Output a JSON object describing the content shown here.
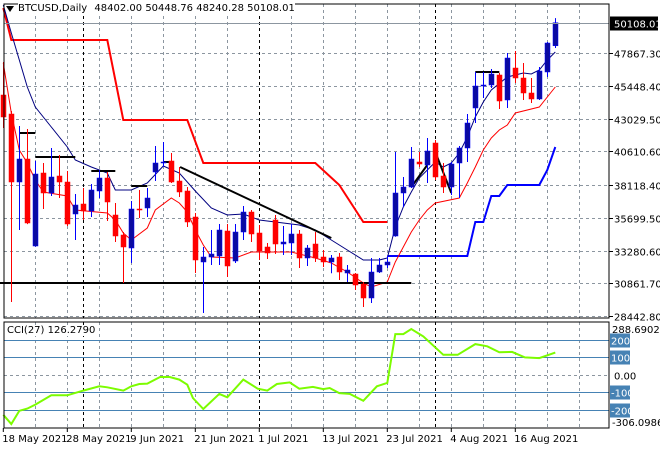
{
  "header": {
    "symbol": "BTCUSD,Daily",
    "open": "48402.00",
    "high": "50448.76",
    "low": "48240.28",
    "close": "50108.01"
  },
  "current_price_label": "50108.01",
  "price_axis": {
    "ticks": [
      "47867.30",
      "45448.40",
      "43029.50",
      "40610.60",
      "38118.40",
      "35699.50",
      "33280.60",
      "30861.70",
      "28442.80"
    ]
  },
  "date_axis": {
    "labels": [
      "18 May 2021",
      "28 May 2021",
      "9 Jun 2021",
      "21 Jun 2021",
      "1 Jul 2021",
      "13 Jul 2021",
      "23 Jul 2021",
      "4 Aug 2021",
      "16 Aug 2021"
    ],
    "label_bar_indices": [
      0,
      8,
      16,
      24,
      32,
      40,
      48,
      56,
      64
    ],
    "month_separator_indices": [
      10,
      32,
      54
    ]
  },
  "colors": {
    "bull_body": "#0a0aa0",
    "bull_wick": "#0000ff",
    "bear": "#ff0000",
    "ma_fast": "#000080",
    "ma_slow": "#ff0000",
    "channel_upper": "#ff0000",
    "channel_lower": "#0000ff",
    "cci": "#7cfc00",
    "cci_levels": "#4682b4",
    "grid": "#8c96a0"
  },
  "candles": [
    [
      44766,
      47204,
      42329,
      43141
    ],
    [
      43363,
      43585,
      29477,
      38340
    ],
    [
      38340,
      42477,
      34795,
      40039
    ],
    [
      40039,
      42255,
      35230,
      35312
    ],
    [
      33613,
      39892,
      33560,
      38931
    ],
    [
      39005,
      39744,
      36346,
      37528
    ],
    [
      37528,
      40852,
      37306,
      38710
    ],
    [
      38784,
      40335,
      37159,
      38340
    ],
    [
      38340,
      39153,
      35091,
      35238
    ],
    [
      35977,
      37454,
      34057,
      36642
    ],
    [
      36715,
      37897,
      35534,
      36198
    ],
    [
      36198,
      38193,
      35755,
      37750
    ],
    [
      37676,
      39227,
      37159,
      38636
    ],
    [
      38636,
      39079,
      35460,
      36863
    ],
    [
      35903,
      36789,
      33909,
      34352
    ],
    [
      34426,
      34647,
      30881,
      33540
    ],
    [
      33465,
      36937,
      32358,
      36346
    ],
    [
      36346,
      37750,
      35681,
      36272
    ],
    [
      36420,
      37897,
      35755,
      37159
    ],
    [
      39079,
      41000,
      38414,
      39744
    ],
    [
      39744,
      41295,
      39448,
      39818
    ],
    [
      39892,
      40483,
      38266,
      38340
    ],
    [
      38414,
      39448,
      37232,
      37602
    ],
    [
      37676,
      37971,
      35017,
      35386
    ],
    [
      35756,
      36051,
      31620,
      32579
    ],
    [
      32432,
      33540,
      28665,
      32801
    ],
    [
      32801,
      34795,
      32210,
      33022
    ],
    [
      32875,
      35238,
      32210,
      34795
    ],
    [
      34721,
      35238,
      31324,
      32136
    ],
    [
      32505,
      35238,
      32358,
      34647
    ],
    [
      34647,
      36567,
      34057,
      36124
    ],
    [
      36124,
      36272,
      33909,
      34500
    ],
    [
      34574,
      35164,
      32579,
      33244
    ],
    [
      33540,
      33835,
      32653,
      33096
    ],
    [
      35534,
      35903,
      33022,
      33761
    ],
    [
      33761,
      35091,
      32949,
      33909
    ],
    [
      33835,
      35238,
      32949,
      34500
    ],
    [
      34500,
      34795,
      31989,
      32727
    ],
    [
      32727,
      33687,
      32136,
      33465
    ],
    [
      33761,
      34647,
      32431,
      32727
    ],
    [
      32801,
      33318,
      32062,
      32432
    ],
    [
      32432,
      32949,
      31604,
      32727
    ],
    [
      32801,
      33096,
      31102,
      31693
    ],
    [
      31619,
      32210,
      30954,
      31841
    ],
    [
      31545,
      31619,
      30364,
      30733
    ],
    [
      30807,
      30954,
      29108,
      29773
    ],
    [
      29773,
      32727,
      29403,
      31693
    ],
    [
      31693,
      32727,
      31619,
      32210
    ],
    [
      32210,
      32875,
      31989,
      32432
    ],
    [
      34352,
      40556,
      34300,
      37528
    ],
    [
      37528,
      38710,
      36494,
      37971
    ],
    [
      37971,
      40926,
      37897,
      40039
    ],
    [
      39818,
      40556,
      39448,
      39670
    ],
    [
      39596,
      41590,
      38266,
      40630
    ],
    [
      41221,
      41443,
      38488,
      38710
    ],
    [
      38784,
      39744,
      37528,
      37971
    ],
    [
      37971,
      39818,
      37380,
      39670
    ],
    [
      39744,
      41000,
      37159,
      40852
    ],
    [
      40852,
      43363,
      39818,
      42698
    ],
    [
      43806,
      46465,
      42698,
      45431
    ],
    [
      45431,
      46465,
      44545,
      45505
    ],
    [
      45505,
      46687,
      45283,
      46317
    ],
    [
      46244,
      46391,
      43732,
      44323
    ],
    [
      44397,
      47868,
      43806,
      47499
    ],
    [
      46760,
      48016,
      45653,
      46022
    ],
    [
      46022,
      47130,
      44397,
      44914
    ],
    [
      44914,
      46022,
      44175,
      44471
    ],
    [
      44471,
      46834,
      44400,
      46539
    ],
    [
      46465,
      48681,
      46096,
      48607
    ],
    [
      48402,
      50448.76,
      48240.28,
      50108.01
    ]
  ],
  "indicators": {
    "ma_fast": [
      [
        0,
        51414
      ],
      [
        1,
        49346
      ],
      [
        2,
        47351
      ],
      [
        3,
        45357
      ],
      [
        4,
        43880
      ],
      [
        6,
        42402
      ],
      [
        8,
        40926
      ],
      [
        9,
        39965
      ],
      [
        11,
        39448
      ],
      [
        13,
        39005
      ],
      [
        14,
        37750
      ],
      [
        16,
        37750
      ],
      [
        18,
        38266
      ],
      [
        20,
        39522
      ],
      [
        22,
        39005
      ],
      [
        24,
        37676
      ],
      [
        26,
        36420
      ],
      [
        28,
        35903
      ],
      [
        30,
        35977
      ],
      [
        32,
        35534
      ],
      [
        35,
        35312
      ],
      [
        37,
        35164
      ],
      [
        39,
        34795
      ],
      [
        41,
        34057
      ],
      [
        43,
        33318
      ],
      [
        45,
        32579
      ],
      [
        47,
        32579
      ],
      [
        48,
        32727
      ],
      [
        49,
        35017
      ],
      [
        50,
        36494
      ],
      [
        51,
        37602
      ],
      [
        52,
        38636
      ],
      [
        54,
        39818
      ],
      [
        55,
        39448
      ],
      [
        56,
        39744
      ],
      [
        57,
        40483
      ],
      [
        58,
        41664
      ],
      [
        59,
        43141
      ],
      [
        60,
        44249
      ],
      [
        61,
        45136
      ],
      [
        63,
        46096
      ],
      [
        65,
        46391
      ],
      [
        66,
        46317
      ],
      [
        67,
        46613
      ],
      [
        68,
        47351
      ],
      [
        69,
        47942
      ]
    ],
    "ma_slow": [
      [
        0,
        47130
      ],
      [
        1,
        43437
      ],
      [
        2,
        40704
      ],
      [
        3,
        39744
      ],
      [
        4,
        38488
      ],
      [
        5,
        37602
      ],
      [
        8,
        37306
      ],
      [
        9,
        36272
      ],
      [
        13,
        36051
      ],
      [
        14,
        35534
      ],
      [
        15,
        34573
      ],
      [
        16,
        34057
      ],
      [
        18,
        34943
      ],
      [
        19,
        36272
      ],
      [
        21,
        37159
      ],
      [
        22,
        36789
      ],
      [
        23,
        36124
      ],
      [
        24,
        34795
      ],
      [
        25,
        33687
      ],
      [
        26,
        32801
      ],
      [
        29,
        32727
      ],
      [
        31,
        33170
      ],
      [
        36,
        33170
      ],
      [
        39,
        32727
      ],
      [
        41,
        32358
      ],
      [
        43,
        31693
      ],
      [
        45,
        30881
      ],
      [
        46,
        30585
      ],
      [
        48,
        30954
      ],
      [
        49,
        32432
      ],
      [
        50,
        33540
      ],
      [
        51,
        34647
      ],
      [
        52,
        35534
      ],
      [
        53,
        36272
      ],
      [
        54,
        36789
      ],
      [
        57,
        37159
      ],
      [
        58,
        38266
      ],
      [
        59,
        39448
      ],
      [
        60,
        40704
      ],
      [
        61,
        41590
      ],
      [
        62,
        42181
      ],
      [
        63,
        42550
      ],
      [
        64,
        43437
      ],
      [
        67,
        43880
      ],
      [
        68,
        44619
      ],
      [
        69,
        45357
      ]
    ],
    "channel_upper": [
      [
        0,
        51192
      ],
      [
        1,
        48829
      ],
      [
        13,
        48829
      ],
      [
        15,
        42920
      ],
      [
        23,
        42920
      ],
      [
        25,
        39744
      ],
      [
        39,
        39744
      ],
      [
        42,
        38119
      ],
      [
        45,
        35386
      ],
      [
        48,
        35386
      ]
    ],
    "channel_lower": [
      [
        48,
        32875
      ],
      [
        58,
        32875
      ],
      [
        59,
        35386
      ],
      [
        60,
        35386
      ],
      [
        61,
        37306
      ],
      [
        62,
        37306
      ],
      [
        63,
        38119
      ],
      [
        67,
        38119
      ],
      [
        68,
        39227
      ],
      [
        69,
        40926
      ]
    ]
  },
  "drawings": {
    "support_line": {
      "price": 30881,
      "from": -1,
      "to": 51
    },
    "trend_line": [
      [
        22.1,
        39448
      ],
      [
        41,
        34205
      ]
    ],
    "levels": [
      [
        2,
        4,
        41960
      ],
      [
        4,
        9,
        40187
      ],
      [
        11,
        14,
        39153
      ],
      [
        16,
        18,
        38045
      ],
      [
        20,
        21,
        39818
      ],
      [
        59,
        62,
        46465
      ]
    ],
    "segments": [
      [
        [
          51,
          37971
        ],
        [
          53,
          39596
        ]
      ],
      [
        [
          54,
          40556
        ],
        [
          56,
          37528
        ]
      ]
    ]
  },
  "cci": {
    "label": "CCI(27) 126.2790",
    "scale_max": "288.6902",
    "scale_min": "-306.0986",
    "levels": [
      "200",
      "100",
      "0.00",
      "-100",
      "-200"
    ],
    "level_values": [
      200,
      100,
      0,
      -100,
      -200
    ],
    "values": [
      [
        0,
        -229
      ],
      [
        1,
        -282
      ],
      [
        2,
        -206
      ],
      [
        3,
        -194
      ],
      [
        4,
        -171
      ],
      [
        6,
        -118
      ],
      [
        8,
        -118
      ],
      [
        10,
        -91
      ],
      [
        12,
        -66
      ],
      [
        13,
        -72
      ],
      [
        15,
        -91
      ],
      [
        16,
        -66
      ],
      [
        17,
        -53
      ],
      [
        18,
        -51
      ],
      [
        19.6,
        -13
      ],
      [
        20.8,
        -13
      ],
      [
        22,
        -28
      ],
      [
        23,
        -57
      ],
      [
        23.7,
        -133
      ],
      [
        25,
        -196
      ],
      [
        27,
        -110
      ],
      [
        28,
        -129
      ],
      [
        30,
        -28
      ],
      [
        31.8,
        -80
      ],
      [
        33,
        -91
      ],
      [
        34.2,
        -53
      ],
      [
        35.8,
        -44
      ],
      [
        37,
        -80
      ],
      [
        38.7,
        -70
      ],
      [
        40,
        -82
      ],
      [
        40.8,
        -76
      ],
      [
        42,
        -105
      ],
      [
        43.3,
        -110
      ],
      [
        45,
        -149
      ],
      [
        46.7,
        -66
      ],
      [
        48,
        -47
      ],
      [
        49,
        232
      ],
      [
        50,
        232
      ],
      [
        51,
        261
      ],
      [
        52.5,
        219
      ],
      [
        55,
        114
      ],
      [
        56.8,
        114
      ],
      [
        59,
        175
      ],
      [
        60.5,
        162
      ],
      [
        62,
        128
      ],
      [
        63.6,
        130
      ],
      [
        65.2,
        99
      ],
      [
        67,
        95
      ],
      [
        69,
        126.28
      ]
    ]
  }
}
